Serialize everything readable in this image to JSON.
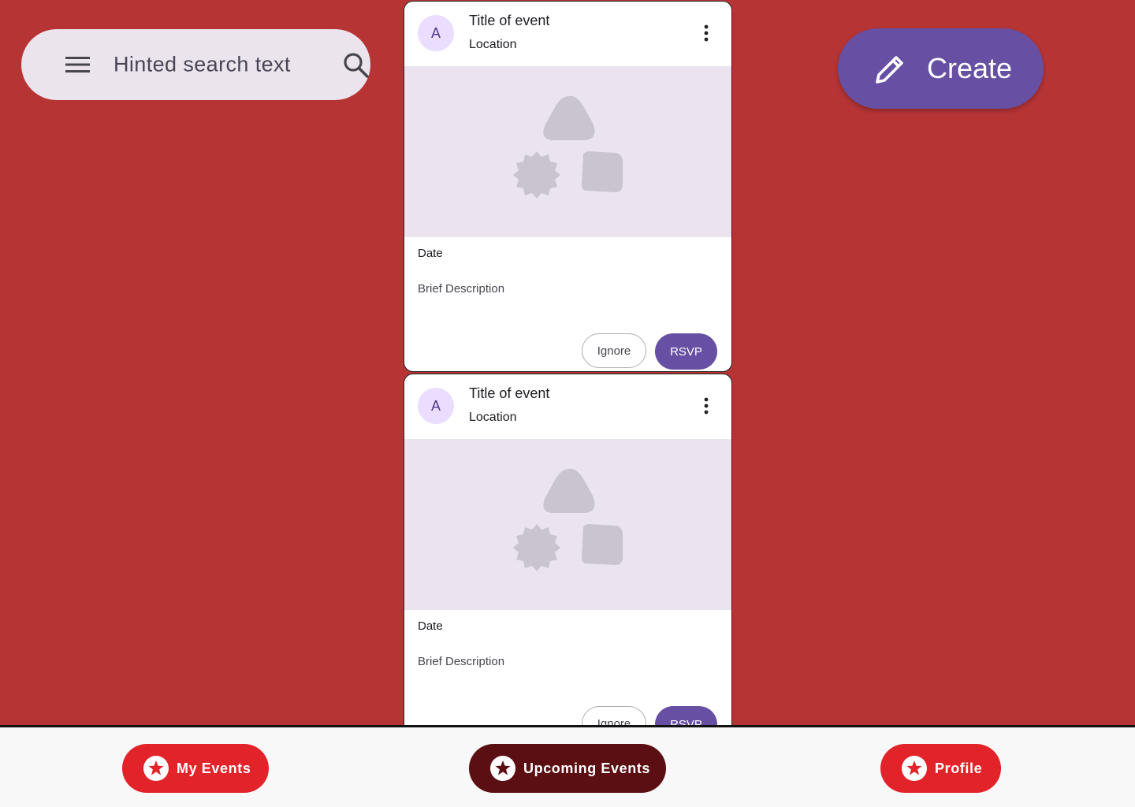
{
  "search": {
    "placeholder": "Hinted search text"
  },
  "create": {
    "label": "Create"
  },
  "cards": [
    {
      "avatar": "A",
      "title": "Title of event",
      "location": "Location",
      "date": "Date",
      "description": "Brief Description",
      "ignore_label": "Ignore",
      "rsvp_label": "RSVP"
    },
    {
      "avatar": "A",
      "title": "Title of event",
      "location": "Location",
      "date": "Date",
      "description": "Brief Description",
      "ignore_label": "Ignore",
      "rsvp_label": "RSVP"
    }
  ],
  "nav": {
    "tabs": [
      {
        "label": "My Events",
        "active": false
      },
      {
        "label": "Upcoming Events",
        "active": true
      },
      {
        "label": "Profile",
        "active": false
      }
    ]
  },
  "colors": {
    "background": "#b73435",
    "primary": "#6750a4",
    "nav_red": "#e3232a",
    "nav_active": "#5b0f13"
  }
}
